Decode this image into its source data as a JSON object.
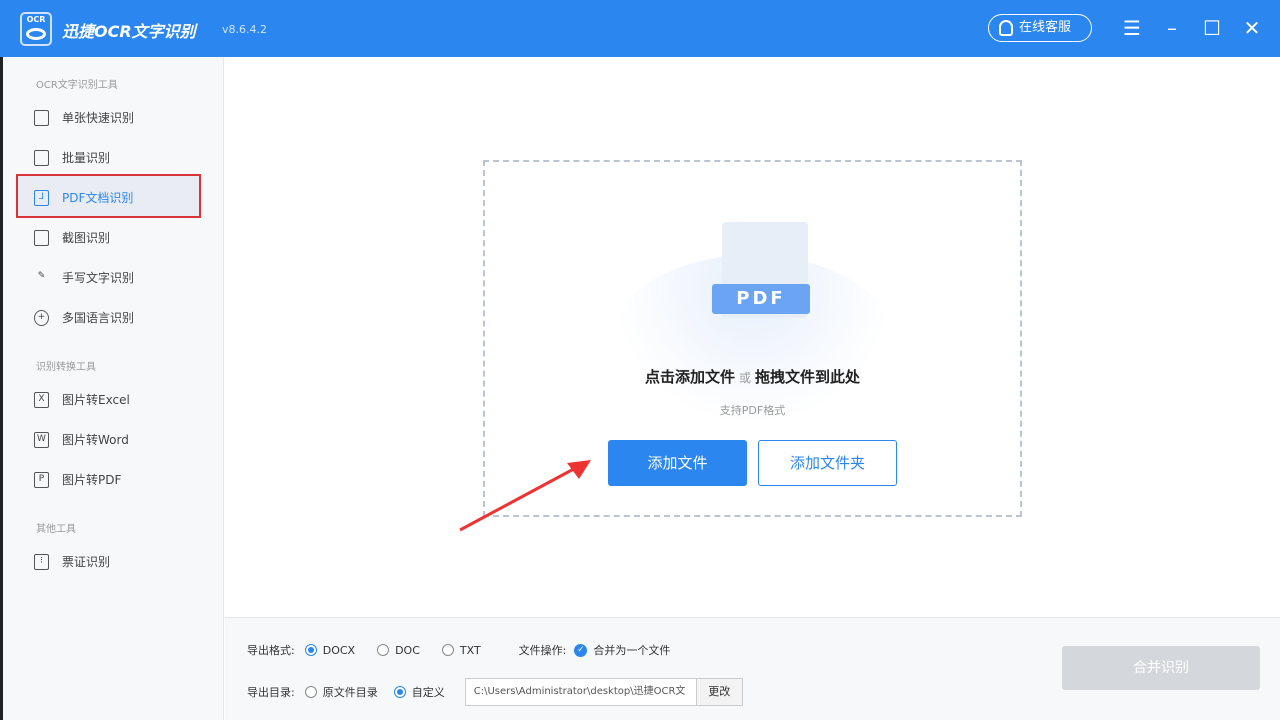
{
  "titlebar": {
    "logo_text": "OCR",
    "app_title": "迅捷OCR文字识别",
    "version": "v8.6.4.2",
    "service_label": "在线客服"
  },
  "sidebar": {
    "sections": [
      {
        "title": "OCR文字识别工具",
        "items": [
          "单张快速识别",
          "批量识别",
          "PDF文档识别",
          "截图识别",
          "手写文字识别",
          "多国语言识别"
        ]
      },
      {
        "title": "识别转换工具",
        "items": [
          "图片转Excel",
          "图片转Word",
          "图片转PDF"
        ]
      },
      {
        "title": "其他工具",
        "items": [
          "票证识别"
        ]
      }
    ],
    "active": "PDF文档识别"
  },
  "drop": {
    "pdf_label": "PDF",
    "primary": "点击添加文件",
    "or": "或",
    "secondary": "拖拽文件到此处",
    "support": "支持PDF格式",
    "add_file": "添加文件",
    "add_folder": "添加文件夹"
  },
  "bottom": {
    "format_label": "导出格式:",
    "formats": [
      "DOCX",
      "DOC",
      "TXT"
    ],
    "format_selected": "DOCX",
    "op_label": "文件操作:",
    "op_option": "合并为一个文件",
    "dir_label": "导出目录:",
    "dir_options": [
      "原文件目录",
      "自定义"
    ],
    "dir_selected": "自定义",
    "path": "C:\\Users\\Administrator\\desktop\\迅捷OCR文",
    "change": "更改",
    "merge": "合并识别"
  },
  "colors": {
    "accent": "#2b86f0",
    "highlight": "#d9343a"
  }
}
